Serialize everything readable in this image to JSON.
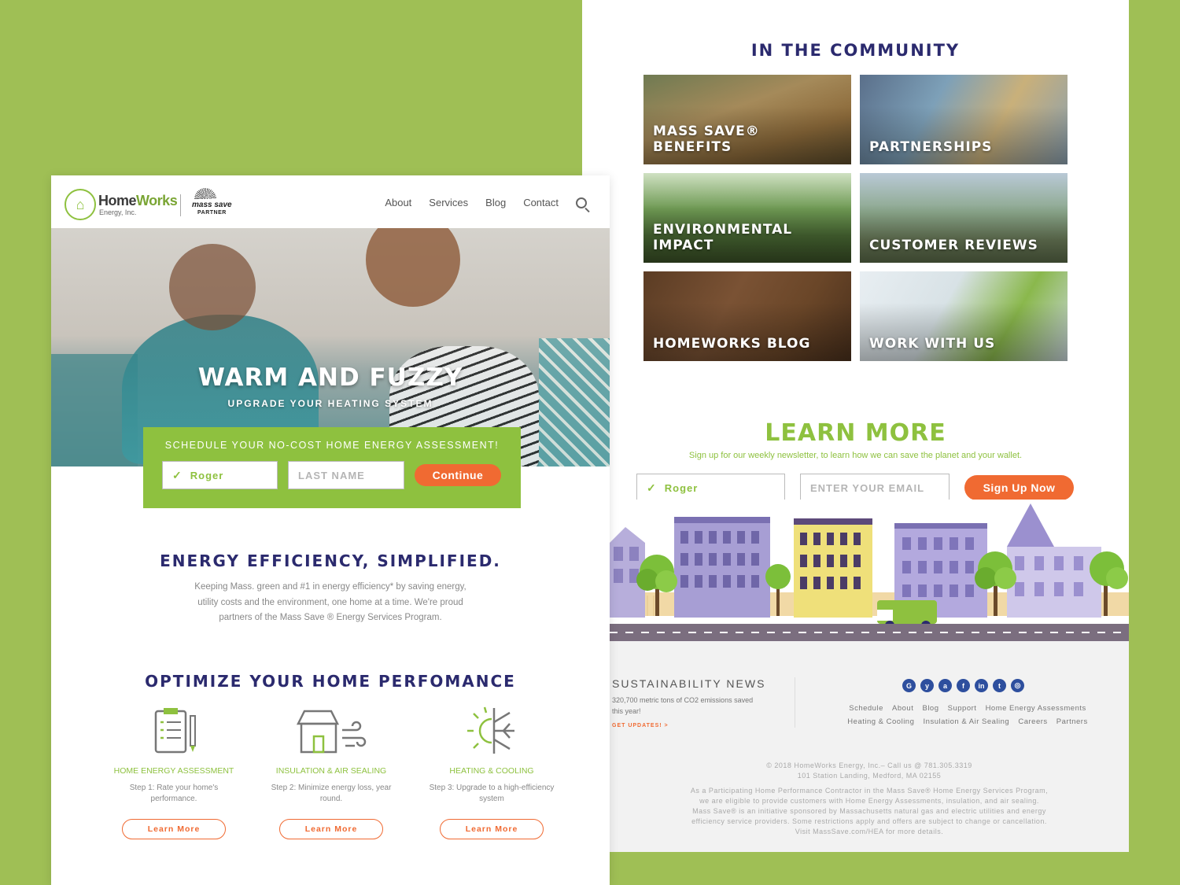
{
  "colors": {
    "background": "#9fbf55",
    "accent_green": "#8ec13f",
    "navy": "#2b2a6e",
    "orange": "#f06a32"
  },
  "community": {
    "title": "IN THE COMMUNITY",
    "tiles": [
      {
        "label": "MASS SAVE®\nBENEFITS"
      },
      {
        "label": "PARTNERSHIPS"
      },
      {
        "label": "ENVIRONMENTAL\nIMPACT"
      },
      {
        "label": "CUSTOMER REVIEWS"
      },
      {
        "label": "HOMEWORKS BLOG"
      },
      {
        "label": "WORK WITH US"
      }
    ]
  },
  "learn_more": {
    "title": "LEARN MORE",
    "subtitle": "Sign up for our weekly newsletter, to learn how we can save the planet and your wallet.",
    "name_value": "Roger",
    "email_placeholder": "ENTER YOUR EMAIL",
    "button": "Sign Up Now"
  },
  "footer": {
    "sustainability_title": "SUSTAINABILITY NEWS",
    "sustainability_text": "320,700 metric tons of CO2 emissions saved this year!",
    "updates_link": "GET UPDATES! >",
    "social_icons": [
      "google-icon",
      "yelp-icon",
      "angies-list-icon",
      "facebook-icon",
      "linkedin-icon",
      "twitter-icon",
      "instagram-icon"
    ],
    "social_glyphs": [
      "G",
      "y",
      "a",
      "f",
      "in",
      "t",
      "◎"
    ],
    "links_row1": [
      "Schedule",
      "About",
      "Blog",
      "Support",
      "Home Energy Assessments"
    ],
    "links_row2": [
      "Heating & Cooling",
      "Insulation & Air Sealing",
      "Careers",
      "Partners"
    ],
    "copyright": "© 2018 HomeWorks Energy, Inc.– Call us @ 781.305.3319",
    "address": "101 Station Landing, Medford, MA 02155",
    "legal": [
      "As a Participating Home Performance Contractor in the Mass Save® Home Energy Services Program,",
      "we are eligible to provide customers with Home Energy Assessments, insulation, and air sealing.",
      "Mass Save® is an initiative sponsored by Massachusetts natural gas and electric utilities and energy",
      "efficiency service providers. Some restrictions apply and offers are subject to change or cancellation.",
      "Visit MassSave.com/HEA for more details."
    ]
  },
  "header": {
    "logo_name_part1": "Home",
    "logo_name_part2": "Works",
    "logo_sub": "Energy, Inc.",
    "partner_name": "mass save",
    "partner_label": "PARTNER",
    "nav": [
      "About",
      "Services",
      "Blog",
      "Contact"
    ]
  },
  "hero": {
    "title": "WARM AND FUZZY",
    "subtitle": "UPGRADE YOUR HEATING SYSTEM"
  },
  "schedule": {
    "title": "SCHEDULE YOUR NO-COST HOME ENERGY ASSESSMENT!",
    "first_name_value": "Roger",
    "last_name_placeholder": "LAST NAME",
    "button": "Continue"
  },
  "efficiency": {
    "title": "ENERGY EFFICIENCY, SIMPLIFIED.",
    "text": "Keeping Mass. green and #1 in energy efficiency* by saving energy, utility costs and the environment, one home at a time. We're proud partners of the Mass Save ® Energy Services Program."
  },
  "optimize": {
    "title": "OPTIMIZE YOUR HOME PERFOMANCE",
    "features": [
      {
        "icon": "clipboard-icon",
        "name": "HOME ENERGY ASSESSMENT",
        "desc": "Step 1: Rate your home's performance.",
        "button": "Learn More"
      },
      {
        "icon": "house-wind-icon",
        "name": "INSULATION & AIR SEALING",
        "desc": "Step 2: Minimize energy loss, year round.",
        "button": "Learn More"
      },
      {
        "icon": "sun-snowflake-icon",
        "name": "HEATING & COOLING",
        "desc": "Step 3: Upgrade to a high-efficiency system",
        "button": "Learn More"
      }
    ]
  }
}
